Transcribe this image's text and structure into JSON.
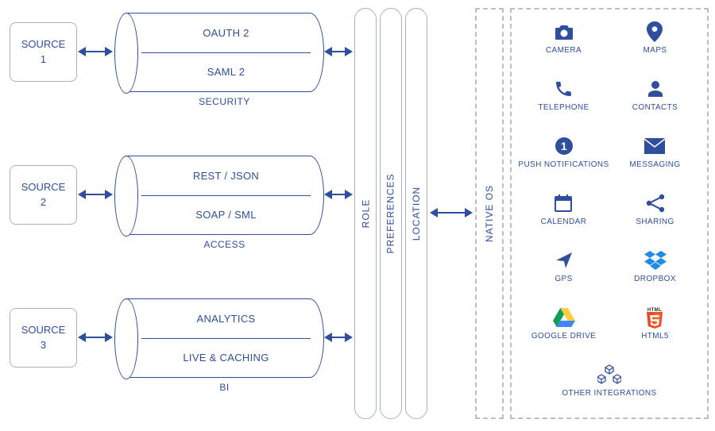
{
  "sources": [
    {
      "label": "SOURCE 1"
    },
    {
      "label": "SOURCE 2"
    },
    {
      "label": "SOURCE 3"
    }
  ],
  "cylinders": [
    {
      "top": "OAUTH 2",
      "bottom": "SAML 2",
      "label": "SECURITY"
    },
    {
      "top": "REST / JSON",
      "bottom": "SOAP / SML",
      "label": "ACCESS"
    },
    {
      "top": "ANALYTICS",
      "bottom": "LIVE & CACHING",
      "label": "BI"
    }
  ],
  "pills": [
    "ROLE",
    "PREFERENCES",
    "LOCATION"
  ],
  "native_os_label": "NATIVE OS",
  "integrations": [
    {
      "name": "CAMERA",
      "icon": "camera"
    },
    {
      "name": "MAPS",
      "icon": "map-pin"
    },
    {
      "name": "TELEPHONE",
      "icon": "phone"
    },
    {
      "name": "CONTACTS",
      "icon": "user"
    },
    {
      "name": "PUSH NOTIFICATIONS",
      "icon": "badge-1"
    },
    {
      "name": "MESSAGING",
      "icon": "envelope"
    },
    {
      "name": "CALENDAR",
      "icon": "calendar"
    },
    {
      "name": "SHARING",
      "icon": "share"
    },
    {
      "name": "GPS",
      "icon": "location-arrow"
    },
    {
      "name": "DROPBOX",
      "icon": "dropbox"
    },
    {
      "name": "GOOGLE DRIVE",
      "icon": "google-drive"
    },
    {
      "name": "HTML5",
      "icon": "html5"
    },
    {
      "name": "OTHER INTEGRATIONS",
      "icon": "cubes"
    }
  ],
  "colors": {
    "brand": "#2f4e9e",
    "muted_border": "#aab2bd",
    "dropbox": "#1f8ce6",
    "html5_orange": "#e44d26"
  }
}
